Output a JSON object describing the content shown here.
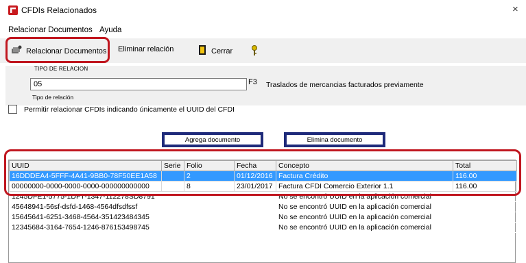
{
  "window": {
    "title": "CFDIs Relacionados",
    "close_glyph": "×"
  },
  "menu": {
    "items": [
      "Relacionar Documentos",
      "Ayuda"
    ]
  },
  "toolbar": {
    "relacionar_label": "Relacionar Documentos",
    "eliminar_label": "Eliminar relación",
    "cerrar_label": "Cerrar"
  },
  "tipo_relacion": {
    "caption": "TIPO DE RELACION",
    "value": "05",
    "f3_label": "F3",
    "description": "Traslados de mercancias facturados previamente",
    "sub_label": "Tipo de relación"
  },
  "checkbox": {
    "label": "Permitir relacionar CFDIs indicando únicamente el UUID del CFDI",
    "checked": false
  },
  "buttons": {
    "agrega": "Agrega documento",
    "elimina": "Elimina documento"
  },
  "table": {
    "headers": [
      "UUID",
      "Serie",
      "Folio",
      "Fecha",
      "Concepto",
      "Total"
    ],
    "rows": [
      [
        "16DDDEA4-5FFF-4A41-9BB0-78F50EE1A58",
        "",
        "2",
        "01/12/2016",
        "Factura Crédito",
        "116.00"
      ],
      [
        "00000000-0000-0000-0000-000000000000",
        "",
        "8",
        "23/01/2017",
        "Factura CFDI Comercio Exterior 1.1",
        "116.00"
      ],
      [
        "1245DFE1-5775-1DFT-1347-112278SD8791",
        "",
        "",
        "",
        "No se encontró UUID en la aplicación comercial",
        ""
      ],
      [
        "45648941-56sf-dsfd-1468-4564dfsdfssf",
        "",
        "",
        "",
        "No se encontró UUID en la aplicación comercial",
        ""
      ],
      [
        "15645641-6251-3468-4564-351423484345",
        "",
        "",
        "",
        "No se encontró UUID en la aplicación comercial",
        ""
      ],
      [
        "12345684-3164-7654-1246-876153498745",
        "",
        "",
        "",
        "No se encontró UUID en la aplicación comercial",
        ""
      ]
    ],
    "selected_row": 0
  },
  "colors": {
    "highlight": "#c0161f",
    "selection": "#3399ff",
    "button_border": "#1e2a7a"
  }
}
